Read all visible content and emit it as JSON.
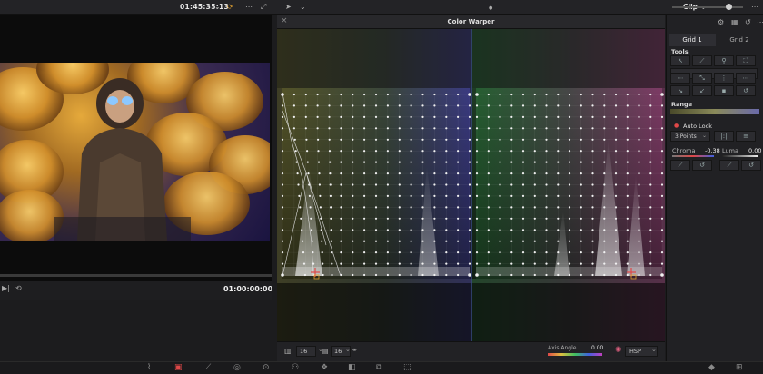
{
  "topbar": {
    "timecode": "01:45:35:13",
    "clip_label": "Clip"
  },
  "viewer": {
    "timecode": "01:00:00:00"
  },
  "warper": {
    "title": "Color Warper",
    "grid_cols_value": "16",
    "grid_rows_value": "16",
    "axis_angle_label": "Axis Angle",
    "axis_angle_value": "0.00",
    "color_space": "HSP"
  },
  "right_panel": {
    "tabs": [
      {
        "label": "Grid 1"
      },
      {
        "label": "Grid 2"
      }
    ],
    "tools_label": "Tools",
    "range_label": "Range",
    "auto_lock_label": "Auto Lock",
    "points_select": "3 Points",
    "chroma_label": "Chroma",
    "chroma_value": "-0.38",
    "luma_label": "Luma",
    "luma_value": "0.00"
  },
  "colors": {
    "accent_red": "#e04848",
    "panel_bg": "#212124",
    "grid_point": "#f2f2f2"
  }
}
